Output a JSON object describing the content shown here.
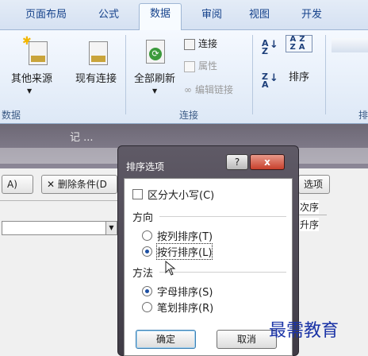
{
  "ribbon": {
    "tabs": [
      "页面布局",
      "公式",
      "数据",
      "审阅",
      "视图",
      "开发"
    ],
    "active_tab": "数据",
    "buttons": {
      "other_sources": "其他来源",
      "existing_connections": "现有连接",
      "refresh_all": "全部刷新",
      "connections": "连接",
      "properties": "属性",
      "edit_links": "编辑链接",
      "sort": "排序"
    },
    "groups": {
      "external_data_partial": "数据",
      "connections": "连接",
      "sort_filter_partial": "排"
    }
  },
  "sort_dialog": {
    "title_partial": "记 ...",
    "add_level_partial": "A)",
    "delete_level": "删除条件",
    "delete_shortcut_partial": "(D",
    "options_partial": "选项",
    "order_label": "次序",
    "order_value": "升序"
  },
  "options_dialog": {
    "title": "排序选项",
    "help_label": "?",
    "close_label": "x",
    "case_sensitive": "区分大小写(C)",
    "direction_heading": "方向",
    "sort_by_column": "按列排序(T)",
    "sort_by_row": "按行排序(L)",
    "method_heading": "方法",
    "alphabetical": "字母排序(S)",
    "stroke_count": "笔划排序(R)",
    "ok_label": "确定",
    "cancel_label": "取消",
    "case_sensitive_checked": false,
    "direction_selected": "sort_by_row",
    "method_selected": "alphabetical"
  },
  "watermark": "最需教育",
  "colors": {
    "ribbon_text": "#15428b",
    "title_bar": "#4f4a56",
    "close_red": "#c8402c",
    "watermark": "#1a33a6"
  }
}
